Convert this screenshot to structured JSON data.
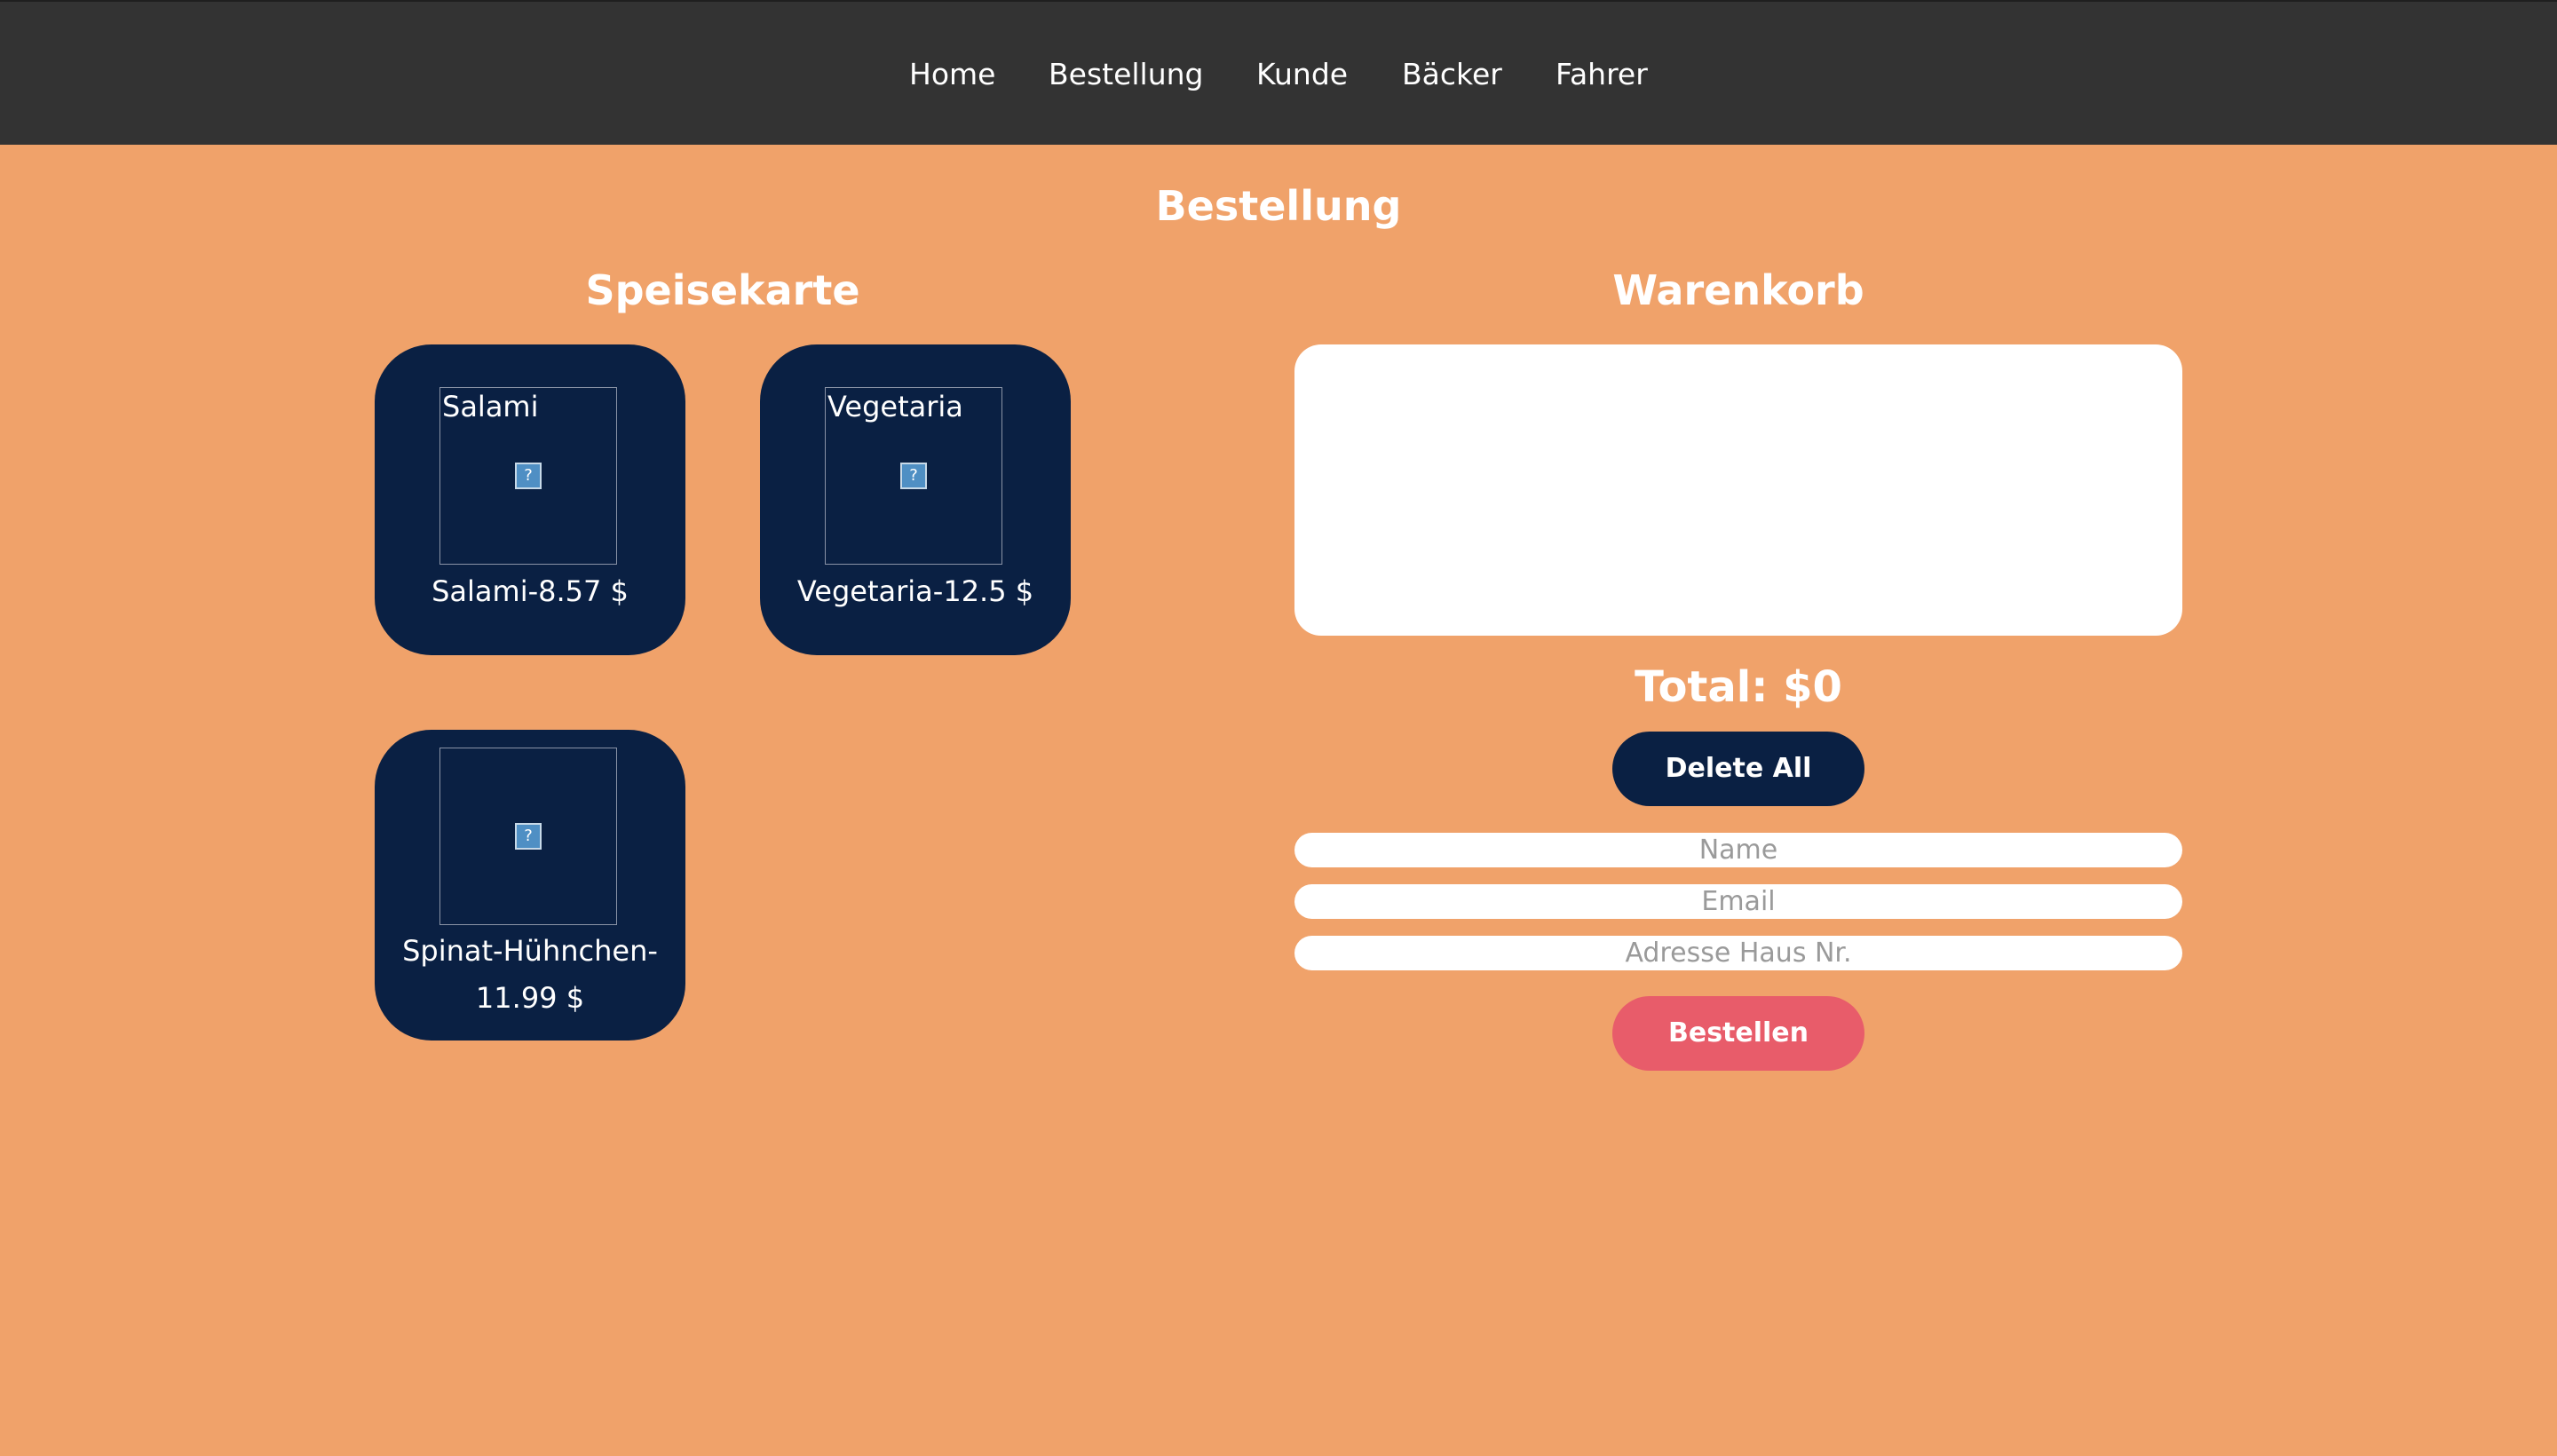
{
  "nav": {
    "items": [
      "Home",
      "Bestellung",
      "Kunde",
      "Bäcker",
      "Fahrer"
    ]
  },
  "page": {
    "title": "Bestellung"
  },
  "menu": {
    "title": "Speisekarte",
    "items": [
      {
        "image_alt": "Salami",
        "label": "Salami-8.57 $"
      },
      {
        "image_alt": "Vegetaria",
        "label": "Vegetaria-12.5 $"
      },
      {
        "image_alt": "",
        "label": "Spinat-Hühnchen-11.99 $"
      }
    ]
  },
  "cart": {
    "title": "Warenkorb",
    "total": "Total: $0",
    "delete_all_label": "Delete All",
    "order_label": "Bestellen",
    "fields": {
      "name_placeholder": "Name",
      "email_placeholder": "Email",
      "address_placeholder": "Adresse Haus Nr."
    }
  },
  "colors": {
    "background": "#f0a26a",
    "nav_background": "#333333",
    "card_background": "#0a2043",
    "order_button": "#e85c6a"
  }
}
